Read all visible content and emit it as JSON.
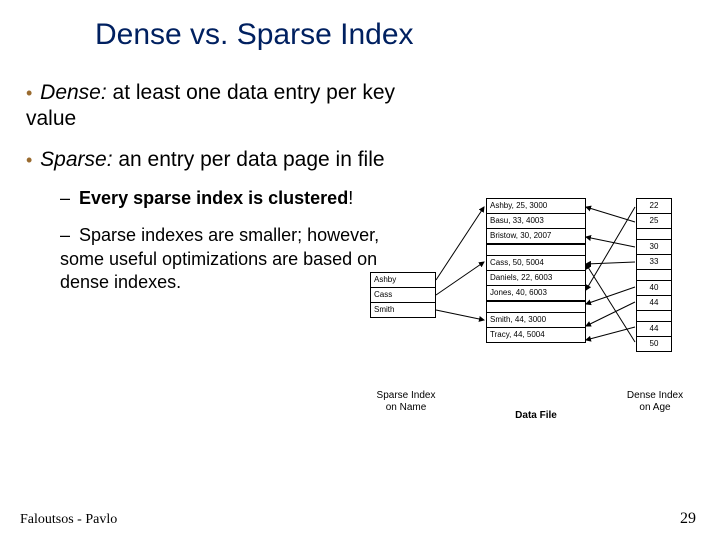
{
  "title": "Dense vs. Sparse Index",
  "bullets": {
    "dense_label": "Dense:",
    "dense_rest": "  at least one data entry per key value",
    "sparse_label": "Sparse:",
    "sparse_rest": " an entry per data page in file",
    "sub1_pre": "Every sparse index is ",
    "sub1_strong": "clustered",
    "sub1_post": "!",
    "sub2": "Sparse indexes are smaller; however, some useful optimizations are based on dense indexes."
  },
  "sparse_index": [
    "Ashby",
    "Cass",
    "Smith"
  ],
  "data_file": [
    "Ashby, 25, 3000",
    "Basu, 33, 4003",
    "Bristow, 30, 2007",
    "Cass, 50, 5004",
    "Daniels, 22, 6003",
    "Jones, 40, 6003",
    "Smith, 44, 3000",
    "Tracy, 44, 5004"
  ],
  "dense_index": [
    "22",
    "25",
    "30",
    "33",
    "40",
    "44",
    "44",
    "50"
  ],
  "labels": {
    "sparse": "Sparse Index on Name",
    "data": "Data File",
    "dense": "Dense Index on Age"
  },
  "footer": "Faloutsos - Pavlo",
  "page": "29",
  "chart_data": {
    "type": "table",
    "title": "Dense vs. Sparse Index",
    "sparse_index_on_name": [
      "Ashby",
      "Cass",
      "Smith"
    ],
    "data_file_records": [
      {
        "name": "Ashby",
        "age": 25,
        "sal": 3000
      },
      {
        "name": "Basu",
        "age": 33,
        "sal": 4003
      },
      {
        "name": "Bristow",
        "age": 30,
        "sal": 2007
      },
      {
        "name": "Cass",
        "age": 50,
        "sal": 5004
      },
      {
        "name": "Daniels",
        "age": 22,
        "sal": 6003
      },
      {
        "name": "Jones",
        "age": 40,
        "sal": 6003
      },
      {
        "name": "Smith",
        "age": 44,
        "sal": 3000
      },
      {
        "name": "Tracy",
        "age": 44,
        "sal": 5004
      }
    ],
    "dense_index_on_age": [
      22,
      25,
      30,
      33,
      40,
      44,
      44,
      50
    ]
  }
}
